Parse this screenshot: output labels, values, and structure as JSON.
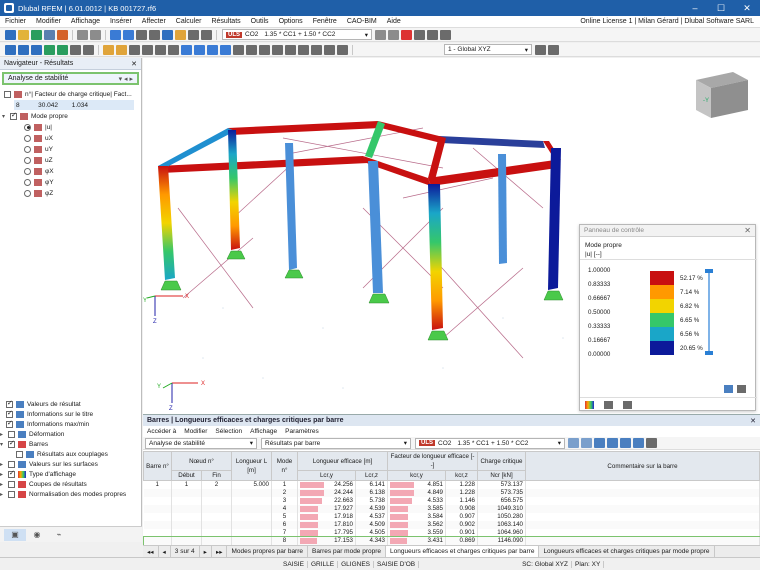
{
  "window": {
    "title": "Dlubal RFEM | 6.01.0012 | KB 001727.rf6"
  },
  "menu": {
    "items": [
      "Fichier",
      "Modifier",
      "Affichage",
      "Insérer",
      "Affecter",
      "Calculer",
      "Résultats",
      "Outils",
      "Options",
      "Fenêtre",
      "CAO-BIM",
      "Aide"
    ],
    "license": "Online License 1 | Milan Gérard | Dlubal Software SARL"
  },
  "toolbar": {
    "load_badge": "ULS",
    "load_case": "CO2",
    "combo_formula": "1.35 * CC1 + 1.50 * CC2",
    "coord_system": "1 - Global XYZ"
  },
  "navigator": {
    "title": "Navigateur - Résultats",
    "selector": "Analyse de stabilité",
    "factor_header": "n°| Facteur de charge critique| Fact...",
    "factor_row": {
      "no": "8",
      "value": "30.042",
      "factor": "1.034"
    },
    "mode_label": "Mode propre",
    "modes": [
      "|u|",
      "uX",
      "uY",
      "uZ",
      "φX",
      "φY",
      "φZ"
    ],
    "bottom_items": [
      "Valeurs de résultat",
      "Informations sur le titre",
      "Informations max/min",
      "Déformation",
      "Barres",
      "Résultats aux couplages",
      "Valeurs sur les surfaces",
      "Type d'affichage",
      "Coupes de résultats",
      "Normalisation des modes propres"
    ]
  },
  "axes": {
    "x": "X",
    "y": "Y",
    "z": "Z"
  },
  "viewcube": {
    "label": "-Y"
  },
  "control_panel": {
    "title": "Panneau de contrôle",
    "subtitle": "Mode propre",
    "unit": "|u| [--]",
    "levels": [
      "1.00000",
      "0.83333",
      "0.66667",
      "0.50000",
      "0.33333",
      "0.16667",
      "0.00000"
    ],
    "percents": [
      "52.17 %",
      "7.14 %",
      "6.82 %",
      "6.65 %",
      "6.56 %",
      "20.65 %"
    ],
    "colors": [
      "#c81010",
      "#ff9900",
      "#f2d400",
      "#35c76a",
      "#1aa6c8",
      "#0c1a9a"
    ]
  },
  "results": {
    "title": "Barres | Longueurs efficaces et charges critiques par barre",
    "menu": [
      "Accéder à",
      "Modifier",
      "Sélection",
      "Affichage",
      "Paramètres"
    ],
    "analysis": "Analyse de stabilité",
    "result_sel": "Résultats par barre",
    "load_badge": "ULS",
    "load_case": "CO2",
    "combo_formula": "1.35 * CC1 + 1.50 * CC2",
    "headers": {
      "bar": "Barre n°",
      "node": "Nœud n°",
      "start": "Début",
      "end": "Fin",
      "length": "Longueur L [m]",
      "mode": "Mode n°",
      "lefgroup": "Longueur efficace [m]",
      "lcry": "Lcr,y",
      "lcrz": "Lcr,z",
      "kgroup": "Facteur de longueur efficace [--]",
      "kcry": "kcr,y",
      "kcrz": "kcr,z",
      "ncrgroup": "Charge critique",
      "ncr": "Ncr [kN]",
      "comment": "Commentaire sur la barre"
    },
    "bar_no": "1",
    "node_start": "1",
    "node_end": "2",
    "length": "5.000",
    "rows": [
      {
        "mode": "1",
        "lcry": "24.256",
        "lcrz": "6.141",
        "kcry": "4.851",
        "kcrz": "1.228",
        "ncr": "573.137"
      },
      {
        "mode": "2",
        "lcry": "24.244",
        "lcrz": "6.138",
        "kcry": "4.849",
        "kcrz": "1.228",
        "ncr": "573.735"
      },
      {
        "mode": "3",
        "lcry": "22.663",
        "lcrz": "5.738",
        "kcry": "4.533",
        "kcrz": "1.146",
        "ncr": "656.575"
      },
      {
        "mode": "4",
        "lcry": "17.927",
        "lcrz": "4.539",
        "kcry": "3.585",
        "kcrz": "0.908",
        "ncr": "1049.310"
      },
      {
        "mode": "5",
        "lcry": "17.918",
        "lcrz": "4.537",
        "kcry": "3.584",
        "kcrz": "0.907",
        "ncr": "1050.280"
      },
      {
        "mode": "6",
        "lcry": "17.810",
        "lcrz": "4.509",
        "kcry": "3.562",
        "kcrz": "0.902",
        "ncr": "1063.140"
      },
      {
        "mode": "7",
        "lcry": "17.795",
        "lcrz": "4.505",
        "kcry": "3.559",
        "kcrz": "0.901",
        "ncr": "1064.960"
      },
      {
        "mode": "8",
        "lcry": "17.153",
        "lcrz": "4.343",
        "kcry": "3.431",
        "kcrz": "0.869",
        "ncr": "1146.090"
      }
    ]
  },
  "tabs": {
    "pager": "3 sur 4",
    "items": [
      "Modes propres par barre",
      "Barres par mode propre",
      "Longueurs efficaces et charges critiques par barre",
      "Longueurs efficaces et charges critiques par mode propre"
    ]
  },
  "status": {
    "items": [
      "SAISIE",
      "GRILLE",
      "GLIGNES",
      "SAISIE D'OB"
    ],
    "cs": "SC: Global XYZ",
    "plane": "Plan: XY"
  }
}
